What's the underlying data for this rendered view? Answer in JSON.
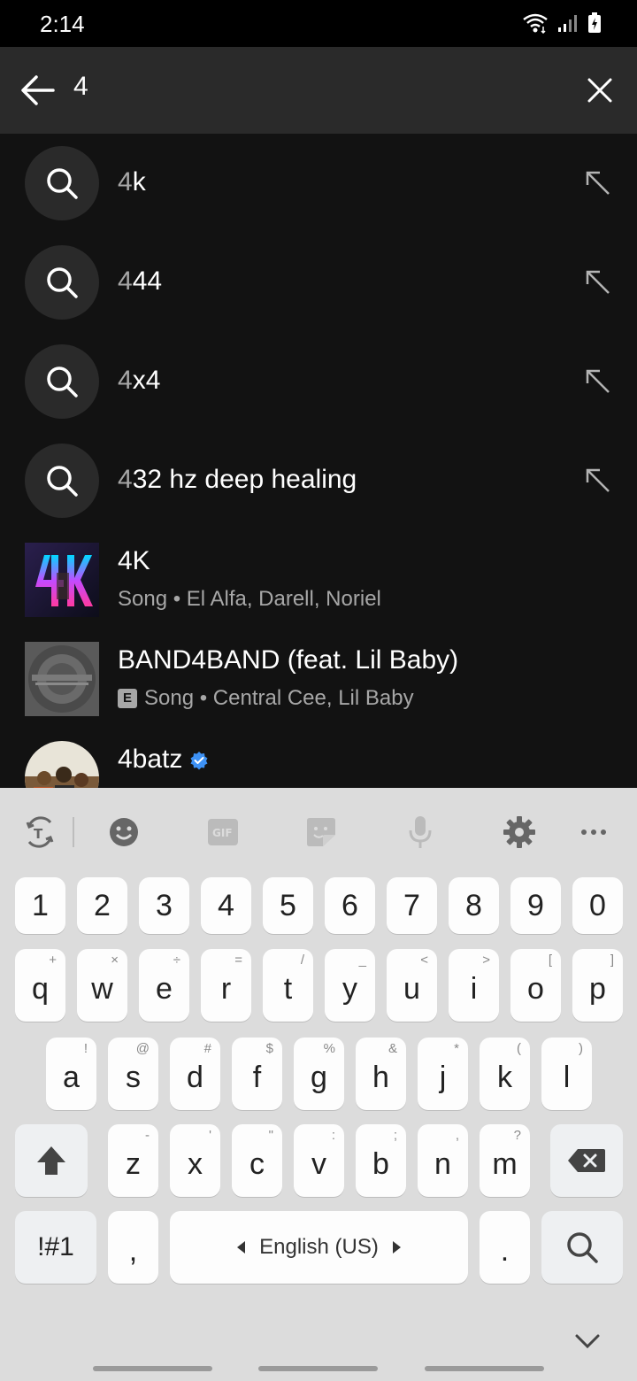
{
  "status_bar": {
    "time": "2:14"
  },
  "search": {
    "query": "4"
  },
  "suggestions": [
    {
      "prefix": "4",
      "rest": "k"
    },
    {
      "prefix": "4",
      "rest": "44"
    },
    {
      "prefix": "4",
      "rest": "x4"
    },
    {
      "prefix": "4",
      "rest": "32 hz deep healing"
    }
  ],
  "results": [
    {
      "title": "4K",
      "explicit": false,
      "subtitle": "Song • El Alfa, Darell, Noriel"
    },
    {
      "title": "BAND4BAND (feat. Lil Baby)",
      "explicit": true,
      "explicit_label": "E",
      "subtitle": "Song • Central Cee, Lil Baby"
    },
    {
      "title": "4batz",
      "verified": true
    }
  ],
  "keyboard": {
    "number_row": [
      "1",
      "2",
      "3",
      "4",
      "5",
      "6",
      "7",
      "8",
      "9",
      "0"
    ],
    "row1": [
      {
        "k": "q",
        "alt": "+"
      },
      {
        "k": "w",
        "alt": "×"
      },
      {
        "k": "e",
        "alt": "÷"
      },
      {
        "k": "r",
        "alt": "="
      },
      {
        "k": "t",
        "alt": "/"
      },
      {
        "k": "y",
        "alt": "_"
      },
      {
        "k": "u",
        "alt": "<"
      },
      {
        "k": "i",
        "alt": ">"
      },
      {
        "k": "o",
        "alt": "["
      },
      {
        "k": "p",
        "alt": "]"
      }
    ],
    "row2": [
      {
        "k": "a",
        "alt": "!"
      },
      {
        "k": "s",
        "alt": "@"
      },
      {
        "k": "d",
        "alt": "#"
      },
      {
        "k": "f",
        "alt": "$"
      },
      {
        "k": "g",
        "alt": "%"
      },
      {
        "k": "h",
        "alt": "&"
      },
      {
        "k": "j",
        "alt": "*"
      },
      {
        "k": "k",
        "alt": "("
      },
      {
        "k": "l",
        "alt": ")"
      }
    ],
    "row3": [
      {
        "k": "z",
        "alt": "-"
      },
      {
        "k": "x",
        "alt": "'"
      },
      {
        "k": "c",
        "alt": "\""
      },
      {
        "k": "v",
        "alt": ":"
      },
      {
        "k": "b",
        "alt": ";"
      },
      {
        "k": "n",
        "alt": ","
      },
      {
        "k": "m",
        "alt": "?"
      }
    ],
    "symbols_label": "!#1",
    "comma_label": ",",
    "space_label": "English (US)",
    "period_label": "."
  },
  "colors": {
    "background": "#121212",
    "header": "#2a2a2a",
    "muted_text": "#a7a7a7",
    "verified": "#3d91f4"
  }
}
